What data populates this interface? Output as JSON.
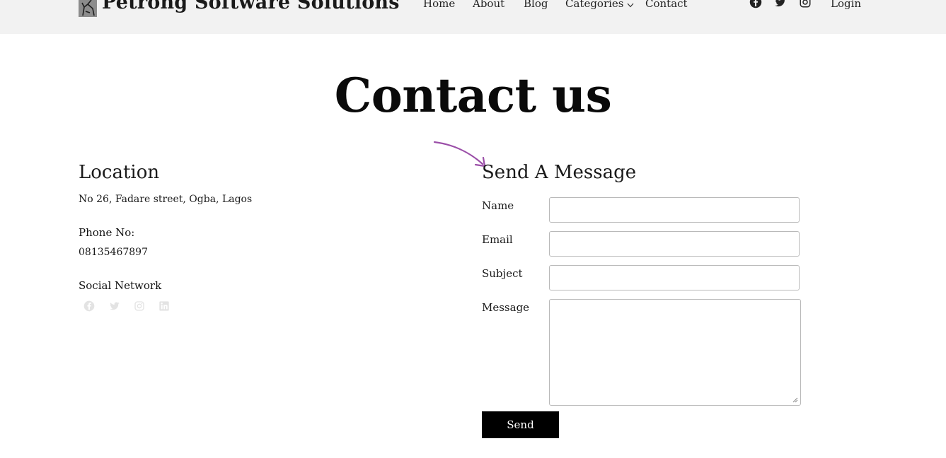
{
  "header": {
    "brand": "Petrong Software Solutions",
    "nav": [
      {
        "label": "Home"
      },
      {
        "label": "About"
      },
      {
        "label": "Blog"
      },
      {
        "label": "Categories"
      },
      {
        "label": "Contact"
      }
    ],
    "icons": [
      "facebook-icon",
      "twitter-icon",
      "instagram-icon"
    ],
    "login_label": "Login"
  },
  "page": {
    "title": "Contact us"
  },
  "location": {
    "heading": "Location",
    "address": "No 26, Fadare street, Ogba, Lagos",
    "phone_label": "Phone No:",
    "phone": "08135467897",
    "social_label": "Social Network",
    "social_icons": [
      "facebook-icon",
      "twitter-icon",
      "instagram-icon",
      "linkedin-icon"
    ]
  },
  "form": {
    "heading": "Send A Message",
    "name_label": "Name",
    "email_label": "Email",
    "subject_label": "Subject",
    "message_label": "Message",
    "name_value": "",
    "email_value": "",
    "subject_value": "",
    "message_value": "",
    "send_label": "Send"
  },
  "colors": {
    "header_bg": "#f2f2f2",
    "button_bg": "#000000",
    "arrow": "#9b4fa8",
    "social_icon": "#e3e3e3"
  }
}
